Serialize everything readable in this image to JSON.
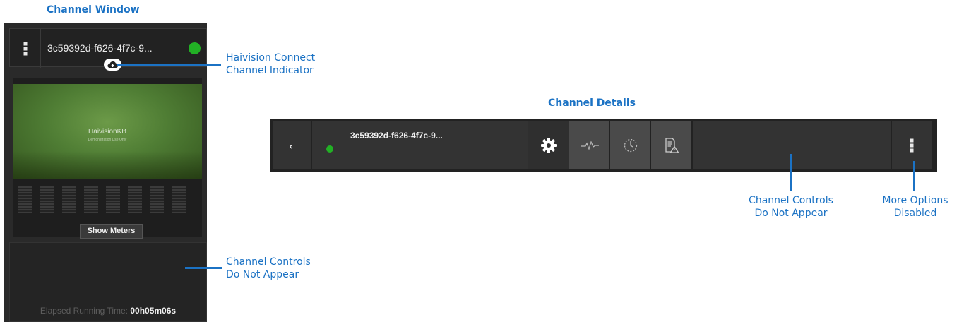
{
  "headings": {
    "channel_window": "Channel Window",
    "channel_details": "Channel Details"
  },
  "channel_window": {
    "channel_name": "3c59392d-f626-4f7c-9...",
    "status_color": "#22b025",
    "preview": {
      "watermark_title": "HaivisionKB",
      "watermark_subtitle": "Demonstration Use Only"
    },
    "show_meters_label": "Show Meters",
    "elapsed_label": "Elapsed Running Time:",
    "elapsed_value": "00h05m06s"
  },
  "channel_details": {
    "back_icon": "chevron-left-icon",
    "channel_name": "3c59392d-f626-4f7c-9...",
    "status_color": "#22b025",
    "tab_icons": [
      "gear-icon",
      "pulse-icon",
      "clock-icon",
      "alert-document-icon"
    ],
    "more_icon": "dots-vertical-icon"
  },
  "callouts": {
    "connect_indicator_line1": "Haivision Connect",
    "connect_indicator_line2": "Channel Indicator",
    "window_controls_line1": "Channel Controls",
    "window_controls_line2": "Do Not Appear",
    "details_controls_line1": "Channel Controls",
    "details_controls_line2": "Do Not Appear",
    "more_options_line1": "More Options",
    "more_options_line2": "Disabled"
  },
  "colors": {
    "callout_blue": "#1b72c4",
    "panel_dark": "#2a2a2a"
  }
}
